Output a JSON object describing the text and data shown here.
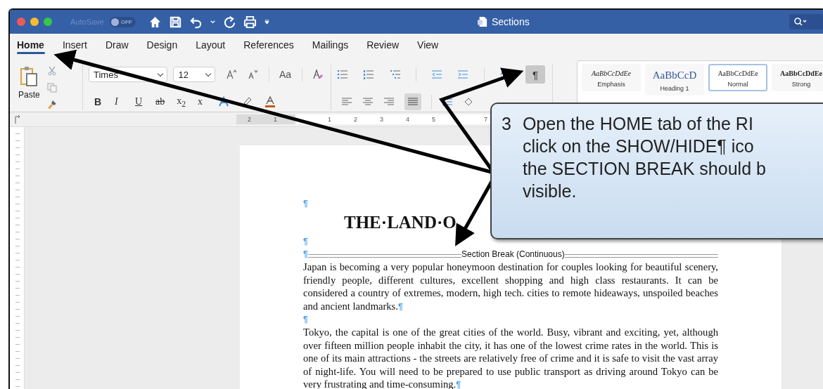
{
  "window": {
    "title": "Sections",
    "autosave": {
      "label": "AutoSave",
      "toggle": "OFF",
      "on": false
    }
  },
  "tabs": [
    {
      "label": "Home",
      "selected": true
    },
    {
      "label": "Insert",
      "selected": false
    },
    {
      "label": "Draw",
      "selected": false
    },
    {
      "label": "Design",
      "selected": false
    },
    {
      "label": "Layout",
      "selected": false
    },
    {
      "label": "References",
      "selected": false
    },
    {
      "label": "Mailings",
      "selected": false
    },
    {
      "label": "Review",
      "selected": false
    },
    {
      "label": "View",
      "selected": false
    }
  ],
  "ribbon": {
    "paste": "Paste",
    "font_name": "Times",
    "font_size": "12",
    "change_case": "Aa",
    "format_buttons": [
      "B",
      "I",
      "U",
      "ab",
      "x$_{2}$",
      "x"
    ],
    "show_hide": {
      "label": "¶",
      "on": true
    },
    "styles": [
      {
        "preview": "AaBbCcDdEe",
        "name": "Emphasis",
        "kind": "emphasis",
        "selected": false
      },
      {
        "preview": "AaBbCcD",
        "name": "Heading 1",
        "kind": "heading",
        "selected": false
      },
      {
        "preview": "AaBbCcDdEe",
        "name": "Normal",
        "kind": "normal",
        "selected": true
      },
      {
        "preview": "AaBbCcDdEe",
        "name": "Strong",
        "kind": "strong",
        "selected": false
      }
    ]
  },
  "ruler": {
    "numbers": [
      "2",
      "1",
      "1",
      "2",
      "3",
      "4",
      "5",
      "7"
    ]
  },
  "document": {
    "blocks": [
      {
        "kind": "empty",
        "mark": "¶"
      },
      {
        "kind": "title",
        "text": "THE·LAND·O"
      },
      {
        "kind": "empty",
        "mark": "¶"
      },
      {
        "kind": "break",
        "mark": "¶",
        "text": "Section Break (Continuous)"
      },
      {
        "kind": "text",
        "text": "Japan is becoming a very popular honeymoon destination for couples looking for beautiful scenery, friendly people, different cultures, excellent shopping and high class restaurants. It can be considered a country of extremes, modern, high tech. cities to remote hideaways, unspoiled beaches and ancient landmarks.",
        "mark": "¶"
      },
      {
        "kind": "empty",
        "mark": "¶"
      },
      {
        "kind": "text",
        "text": "Tokyo, the capital is one of the great cities of the world. Busy, vibrant and exciting, yet, although over fifteen million people inhabit the city, it has one of the lowest crime rates in the world. This is one of its main attractions - the streets are relatively free of crime and it is safe to visit the vast array of night-life. You will need to be prepared to use public transport as driving around Tokyo can be very frustrating and time-consuming.",
        "mark": "¶"
      }
    ]
  },
  "callout": {
    "number": "3",
    "lines": [
      "Open the HOME tab of the RI",
      "click on the SHOW/HIDE¶ ico",
      "the SECTION BREAK should b",
      "visible."
    ]
  }
}
